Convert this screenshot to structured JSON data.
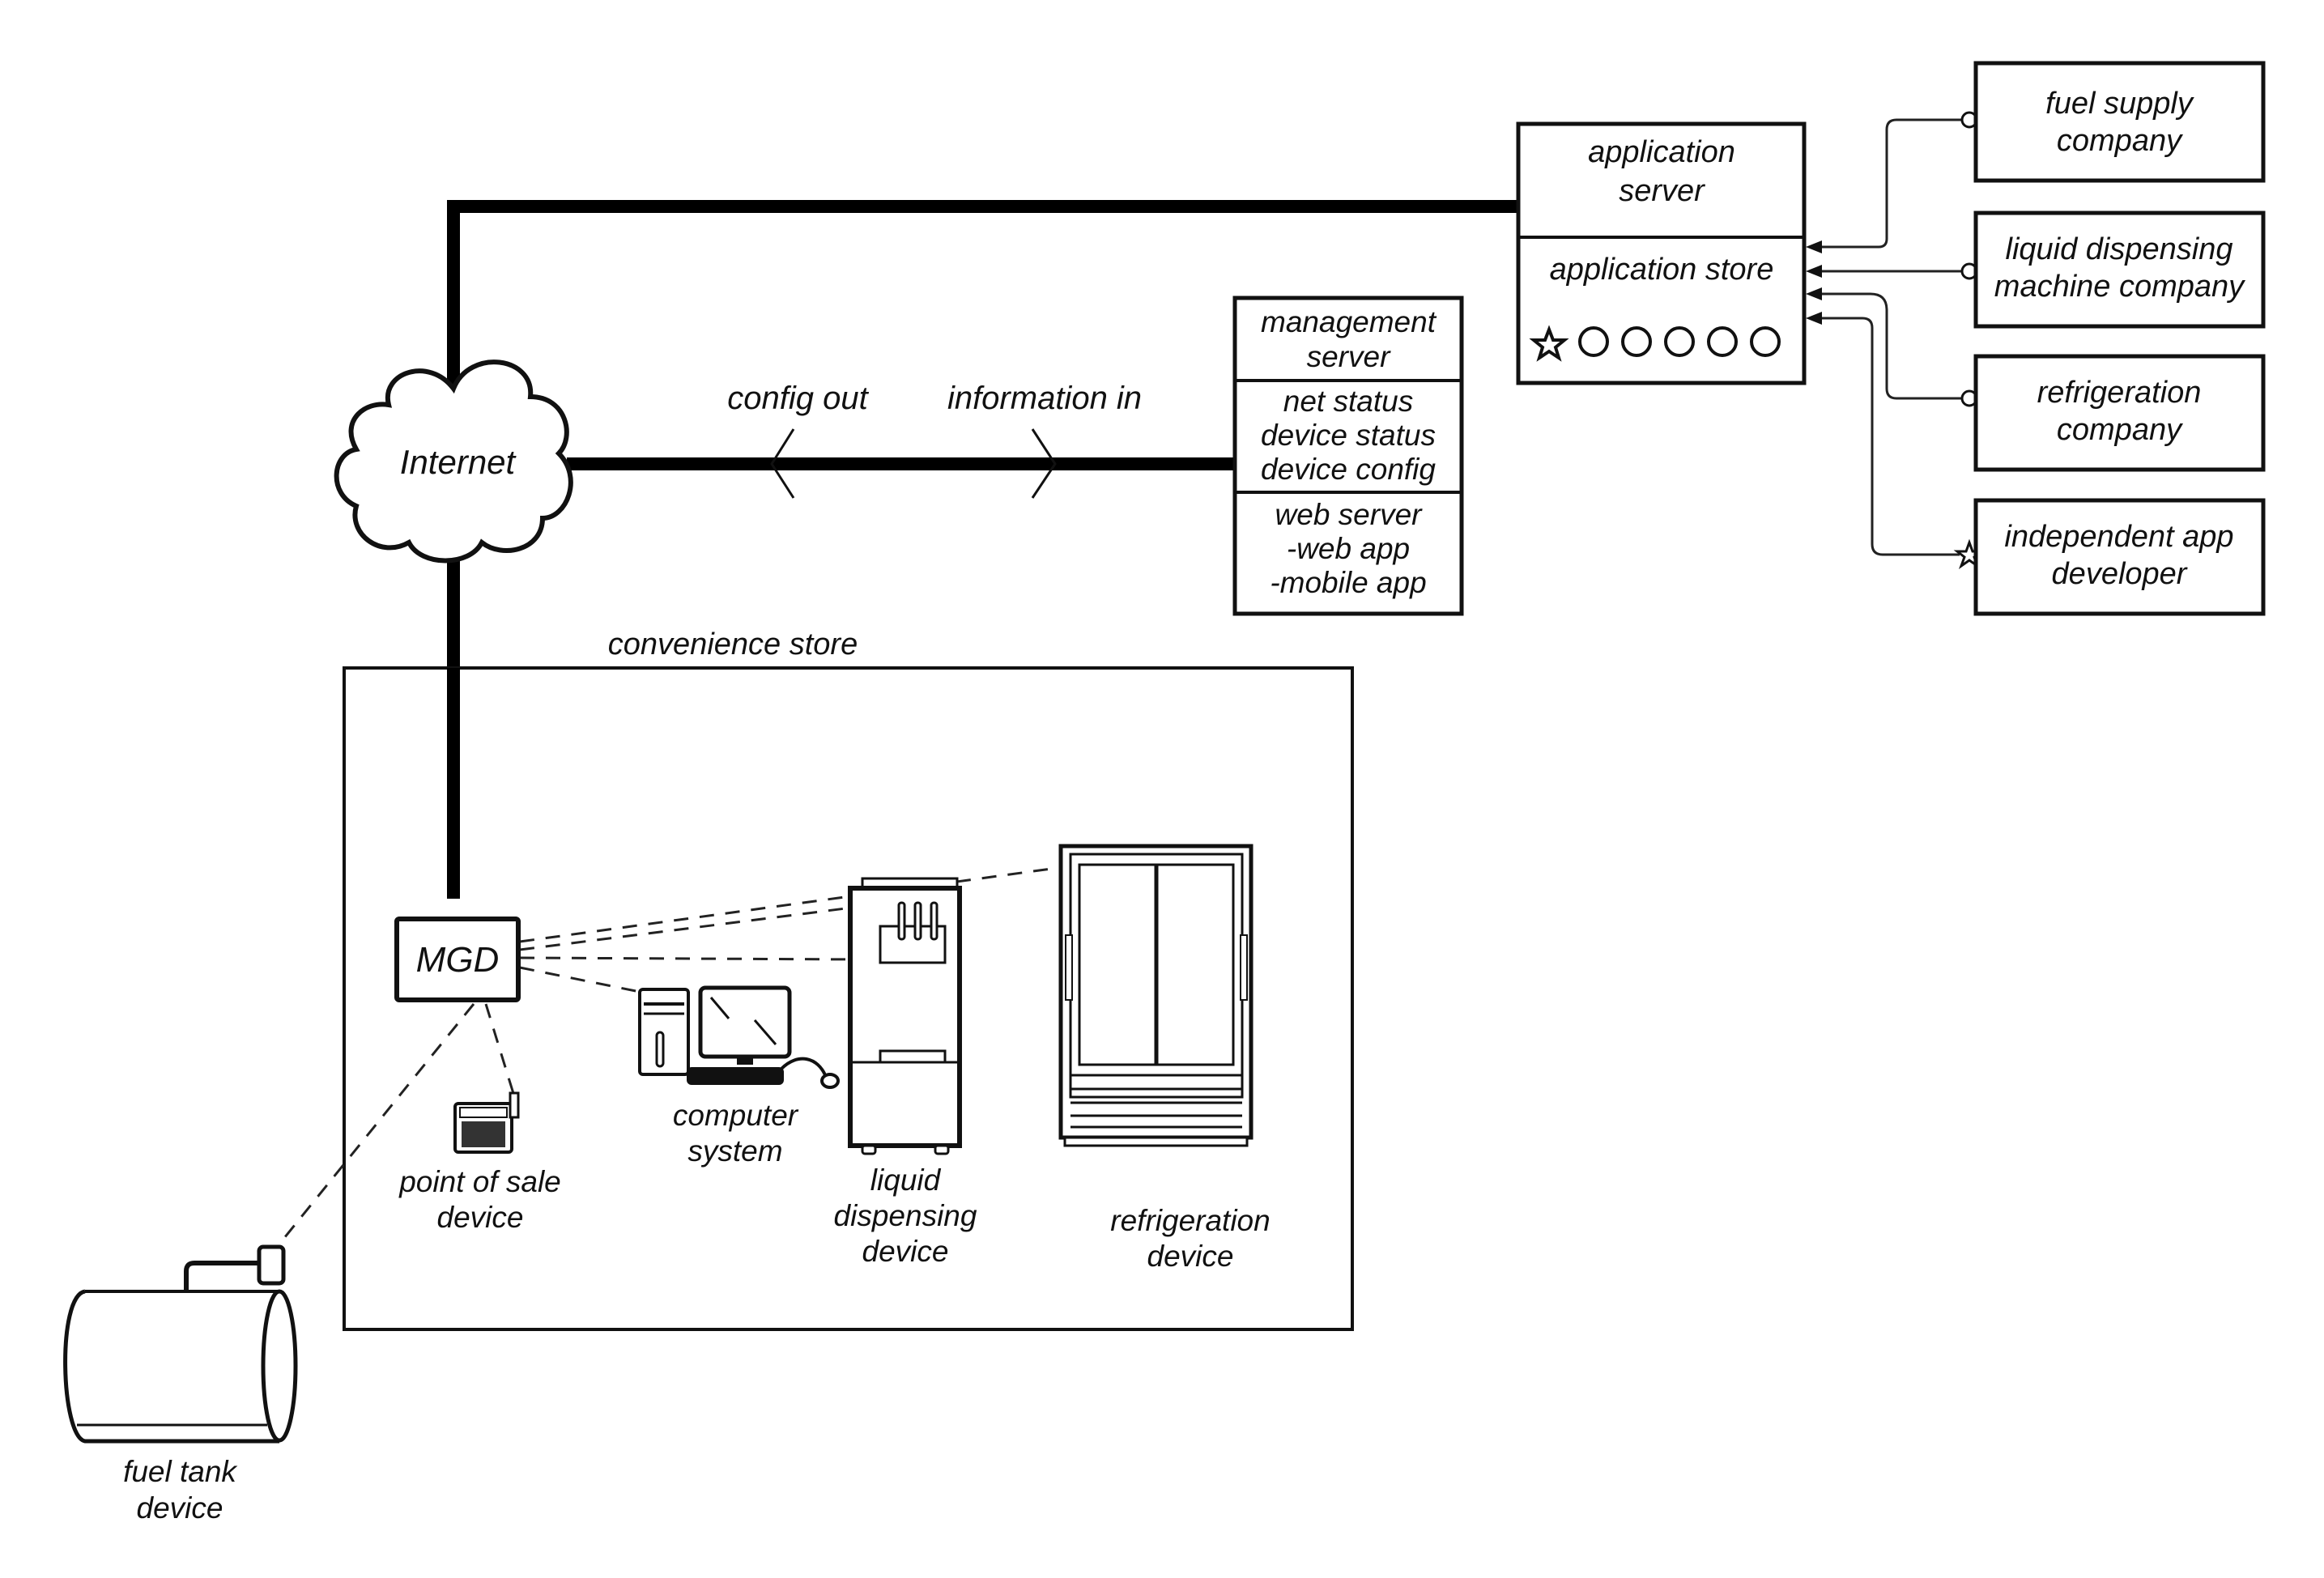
{
  "diagram": {
    "internet": {
      "label": "Internet"
    },
    "link_labels": {
      "config_out": "config out",
      "information_in": "information in"
    },
    "application_server": {
      "title_lines": [
        "application",
        "server"
      ],
      "store_label": "application store",
      "store_icons": [
        "star-icon",
        "circle-icon",
        "circle-icon",
        "circle-icon",
        "circle-icon",
        "circle-icon"
      ]
    },
    "management_server": {
      "title_lines": [
        "management",
        "server"
      ],
      "status_lines": [
        "net status",
        "device status",
        "device config"
      ],
      "web_lines": [
        "web server",
        "-web app",
        "-mobile app"
      ]
    },
    "companies": [
      {
        "lines": [
          "fuel supply",
          "company"
        ],
        "connector": "circle"
      },
      {
        "lines": [
          "liquid dispensing",
          "machine company"
        ],
        "connector": "circle"
      },
      {
        "lines": [
          "refrigeration",
          "company"
        ],
        "connector": "circle"
      },
      {
        "lines": [
          "independent app",
          "developer"
        ],
        "connector": "star"
      }
    ],
    "store": {
      "label": "convenience store",
      "mgd_label": "MGD",
      "devices": {
        "computer": [
          "computer",
          "system"
        ],
        "pos": [
          "point of sale",
          "device"
        ],
        "liquid": [
          "liquid",
          "dispensing",
          "device"
        ],
        "refrigeration": [
          "refrigeration",
          "device"
        ]
      }
    },
    "fuel_tank": {
      "lines": [
        "fuel tank",
        "device"
      ]
    }
  }
}
